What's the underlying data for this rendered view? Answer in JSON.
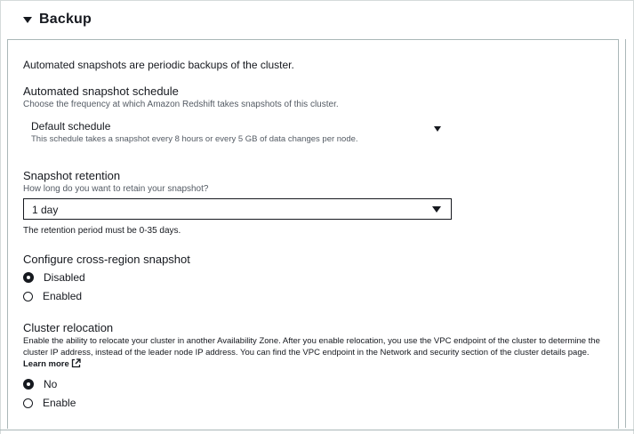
{
  "section": {
    "title": "Backup"
  },
  "intro": "Automated snapshots are periodic backups of the cluster.",
  "schedule": {
    "label": "Automated snapshot schedule",
    "description": "Choose the frequency at which Amazon Redshift takes snapshots of this cluster.",
    "selected_name": "Default schedule",
    "selected_description": "This schedule takes a snapshot every 8 hours or every 5 GB of data changes per node."
  },
  "retention": {
    "label": "Snapshot retention",
    "description": "How long do you want to retain your snapshot?",
    "value": "1 day",
    "constraint": "The retention period must be 0-35 days."
  },
  "cross_region": {
    "label": "Configure cross-region snapshot",
    "options": [
      {
        "label": "Disabled",
        "checked": true
      },
      {
        "label": "Enabled",
        "checked": false
      }
    ]
  },
  "relocation": {
    "label": "Cluster relocation",
    "description": "Enable the ability to relocate your cluster in another Availability Zone. After you enable relocation, you use the VPC endpoint of the cluster to determine the cluster IP address, instead of the leader node IP address. You can find the VPC endpoint in the Network and security section of the cluster details page.",
    "learn_more": "Learn more",
    "options": [
      {
        "label": "No",
        "checked": true
      },
      {
        "label": "Enable",
        "checked": false
      }
    ]
  },
  "icons": {
    "section_toggle": "caret-down-icon",
    "dropdown": "caret-down-icon",
    "external_link": "external-link-icon",
    "radio": "radio-button-icon"
  }
}
